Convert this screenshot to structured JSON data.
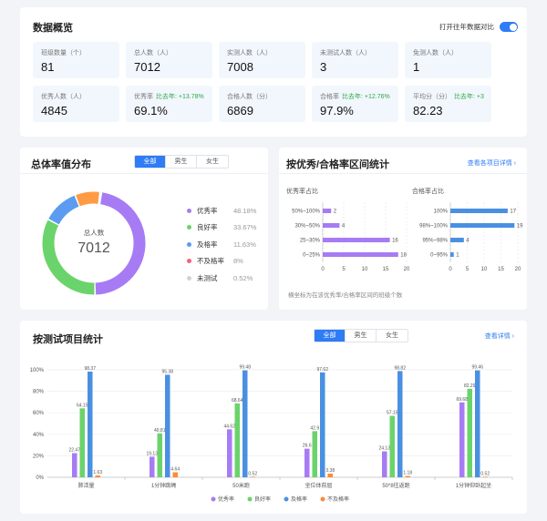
{
  "overview": {
    "title": "数据概览",
    "toggle_label": "打开往年数据对比",
    "stats": [
      {
        "label": "班级数量（个）",
        "value": "81",
        "compare": ""
      },
      {
        "label": "总人数（人）",
        "value": "7012",
        "compare": ""
      },
      {
        "label": "实测人数（人）",
        "value": "7008",
        "compare": ""
      },
      {
        "label": "未测试人数（人）",
        "value": "3",
        "compare": ""
      },
      {
        "label": "免测人数（人）",
        "value": "1",
        "compare": ""
      },
      {
        "label": "优秀人数（人）",
        "value": "4845",
        "compare": ""
      },
      {
        "label": "优秀率",
        "value": "69.1%",
        "compare": "比去年: +13.78%"
      },
      {
        "label": "合格人数（分）",
        "value": "6869",
        "compare": ""
      },
      {
        "label": "合格率",
        "value": "97.9%",
        "compare": "比去年: +12.76%"
      },
      {
        "label": "平均分（分）",
        "value": "82.23",
        "compare": "比去年: +3"
      }
    ]
  },
  "distribution": {
    "title": "总体率值分布",
    "tabs": [
      "全部",
      "男生",
      "女生"
    ],
    "center_label": "总人数",
    "center_value": "7012",
    "legend": [
      {
        "name": "优秀率",
        "pct": "48.18%",
        "color": "#a77bf3"
      },
      {
        "name": "良好率",
        "pct": "33.67%",
        "color": "#6bd36b"
      },
      {
        "name": "及格率",
        "pct": "11.63%",
        "color": "#5b9cf0"
      },
      {
        "name": "不及格率",
        "pct": "8%",
        "color": "#f2627a"
      },
      {
        "name": "未测试",
        "pct": "0.52%",
        "color": "#cfd3d8"
      }
    ],
    "donut_colors": [
      "#a77bf3",
      "#6bd36b",
      "#5b9cf0",
      "#ff9b45",
      "#cfd3d8"
    ]
  },
  "range": {
    "title": "按优秀/合格率区间统计",
    "link": "查看各项目详情 ›",
    "note": "横坐标为在该优秀率/合格率区间的班级个数"
  },
  "project": {
    "title": "按测试项目统计",
    "tabs": [
      "全部",
      "男生",
      "女生"
    ],
    "link": "查看详情 ›"
  },
  "chart_data": [
    {
      "type": "pie",
      "title": "",
      "categories": [
        "优秀率",
        "良好率",
        "及格率",
        "不及格率",
        "未测试"
      ],
      "values": [
        48.18,
        33.67,
        11.63,
        8,
        0.52
      ]
    },
    {
      "type": "bar",
      "title": "优秀率占比",
      "orientation": "horizontal",
      "categories": [
        "50%~100%",
        "30%~50%",
        "25~30%",
        "0~25%"
      ],
      "values": [
        2,
        4,
        16,
        18
      ],
      "xlim": [
        0,
        20
      ],
      "xticks": [
        0,
        5,
        10,
        15,
        20
      ],
      "color": "#a77bf3"
    },
    {
      "type": "bar",
      "title": "合格率占比",
      "orientation": "horizontal",
      "categories": [
        "100%",
        "98%~100%",
        "95%~98%",
        "0~95%"
      ],
      "values": [
        17,
        19,
        4,
        1
      ],
      "xlim": [
        0,
        20
      ],
      "xticks": [
        0,
        5,
        10,
        15,
        20
      ],
      "color": "#4a90e2"
    },
    {
      "type": "bar",
      "title": "",
      "categories": [
        "肺活量",
        "1分钟跳绳",
        "50米跑",
        "坐位体前屈",
        "50*8往返跑",
        "1分钟仰卧起坐"
      ],
      "ylim": [
        0,
        100
      ],
      "yticks": [
        0,
        20,
        40,
        60,
        80,
        100
      ],
      "series": [
        {
          "name": "优秀率",
          "color": "#a77bf3",
          "values": [
            22.47,
            19.13,
            44.62,
            26.6,
            24.13,
            69.68
          ],
          "labels": [
            "22.47",
            "19.13",
            "44.62",
            "26.6",
            "24.13",
            "69.68"
          ]
        },
        {
          "name": "良好率",
          "color": "#6bd36b",
          "values": [
            64.15,
            40.81,
            68.64,
            42.9,
            57.15,
            82.29
          ],
          "labels": [
            "64.15",
            "40.81",
            "68.64",
            "42.9",
            "57.15",
            "82.29"
          ]
        },
        {
          "name": "及格率",
          "color": "#4a90e2",
          "values": [
            98.37,
            95.38,
            99.48,
            97.62,
            98.82,
            99.46
          ],
          "labels": [
            "98.37",
            "95.38",
            "99.48",
            "97.62",
            "98.82",
            "99.46"
          ]
        },
        {
          "name": "不及格率",
          "color": "#ff8a34",
          "values": [
            1.63,
            4.64,
            0.52,
            3.38,
            1.18,
            0.52
          ],
          "labels": [
            "1.63",
            "4.64",
            "0.52",
            "3.38",
            "1.18",
            "0.52"
          ]
        }
      ]
    }
  ]
}
